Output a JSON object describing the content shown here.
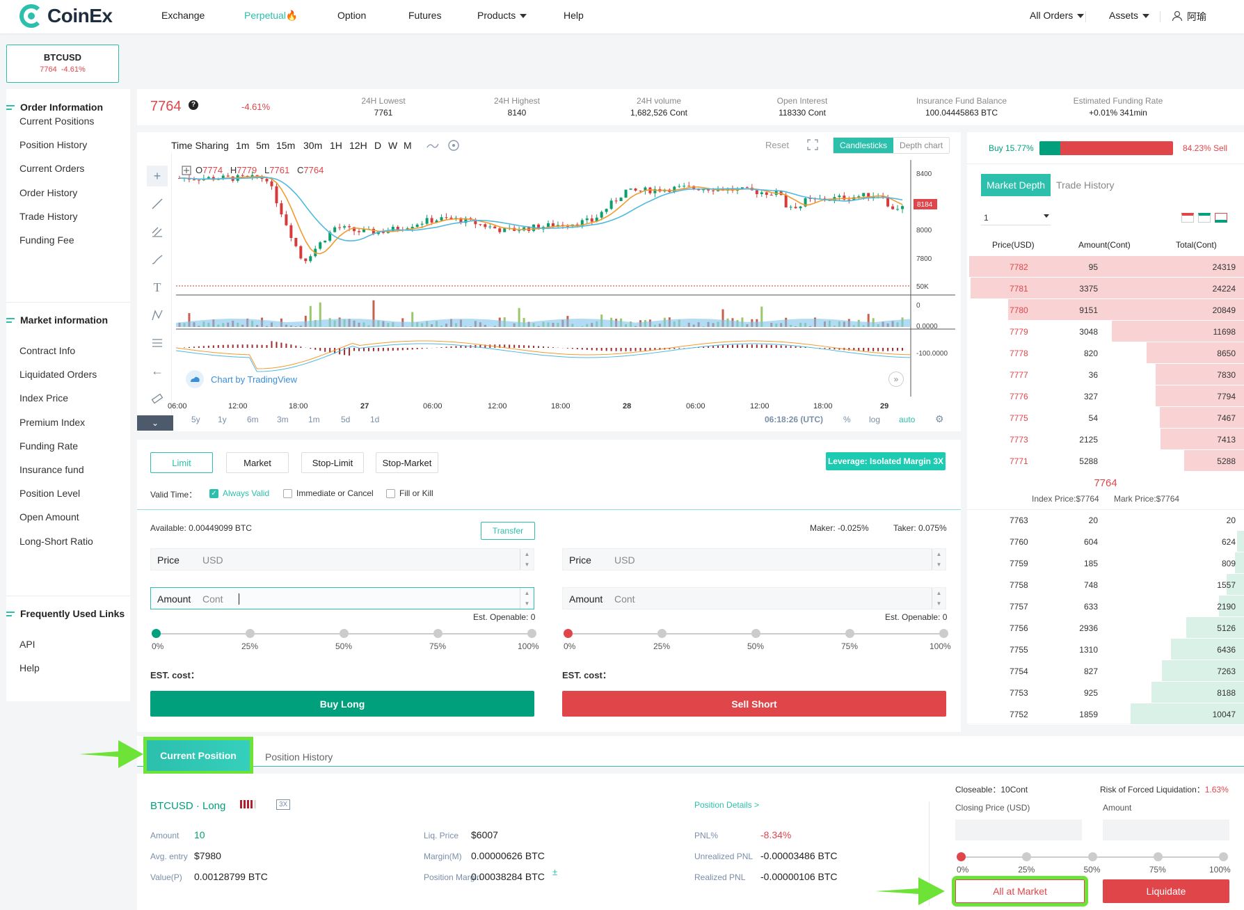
{
  "brand": {
    "name": "CoinEx"
  },
  "nav": {
    "items": [
      "Exchange",
      "Perpetual🔥",
      "Option",
      "Futures",
      "Products",
      "Help"
    ],
    "all_orders": "All Orders",
    "assets": "Assets",
    "user": "阿瑜"
  },
  "symbol": {
    "name": "BTCUSD",
    "price": "7764",
    "change": "-4.61%"
  },
  "sidebar": {
    "order_info": "Order Information",
    "order_items": [
      "Current Positions",
      "Position History",
      "Current Orders",
      "Order History",
      "Trade History",
      "Funding Fee"
    ],
    "market_info": "Market information",
    "market_items": [
      "Contract Info",
      "Liquidated Orders",
      "Index Price",
      "Premium Index",
      "Funding Rate",
      "Insurance fund",
      "Position Level",
      "Open Amount",
      "Long-Short Ratio"
    ],
    "links": "Frequently Used Links",
    "link_items": [
      "API",
      "Help"
    ]
  },
  "ticker": {
    "price": "7764",
    "change": "-4.61%",
    "stats": [
      {
        "label": "24H Lowest",
        "value": "7761"
      },
      {
        "label": "24H Highest",
        "value": "8140"
      },
      {
        "label": "24H volume",
        "value": "1,682,526 Cont"
      },
      {
        "label": "Open Interest",
        "value": "118330 Cont"
      },
      {
        "label": "Insurance Fund Balance",
        "value": "100.04445863 BTC"
      },
      {
        "label": "Estimated Funding Rate",
        "value": "+0.01% 341min"
      }
    ]
  },
  "chart": {
    "timeframes": [
      "Time Sharing",
      "1m",
      "5m",
      "15m",
      "30m",
      "1H",
      "12H",
      "D",
      "W",
      "M"
    ],
    "reset": "Reset",
    "types": [
      "Candlesticks",
      "Depth chart"
    ],
    "ohlc": {
      "o": "O",
      "o_val": "7774",
      "h": "H",
      "h_val": "7779",
      "l": "L",
      "l_val": "7761",
      "c": "C",
      "c_val": "7764"
    },
    "y_ticks": [
      "8400",
      "8184",
      "8000",
      "7800"
    ],
    "vol_ticks": [
      "50K",
      "0"
    ],
    "macd_ticks": [
      "0.0000",
      "-100.0000"
    ],
    "x_ticks": [
      "06:00",
      "12:00",
      "18:00",
      "27",
      "06:00",
      "12:00",
      "18:00",
      "28",
      "06:00",
      "12:00",
      "18:00",
      "29"
    ],
    "ranges": [
      "5y",
      "1y",
      "6m",
      "3m",
      "1m",
      "5d",
      "1d"
    ],
    "time": "06:18:26 (UTC)",
    "pct": "%",
    "log": "log",
    "auto": "auto",
    "attribution": "Chart by TradingView"
  },
  "ratio": {
    "buy": "Buy 15.77%",
    "sell": "84.23% Sell",
    "buy_fraction": 0.1577
  },
  "book": {
    "tabs": [
      "Market Depth",
      "Trade History"
    ],
    "precision": "1",
    "headers": [
      "Price(USD)",
      "Amount(Cont)",
      "Total(Cont)"
    ],
    "asks": [
      [
        "7782",
        "95",
        "24319"
      ],
      [
        "7781",
        "3375",
        "24224"
      ],
      [
        "7780",
        "9151",
        "20849"
      ],
      [
        "7779",
        "3048",
        "11698"
      ],
      [
        "7778",
        "820",
        "8650"
      ],
      [
        "7777",
        "36",
        "7830"
      ],
      [
        "7776",
        "327",
        "7794"
      ],
      [
        "7775",
        "54",
        "7467"
      ],
      [
        "7773",
        "2125",
        "7413"
      ],
      [
        "7771",
        "5288",
        "5288"
      ]
    ],
    "last": "7764",
    "index": "Index Price:$7764",
    "mark": "Mark Price:$7764",
    "bids": [
      [
        "7763",
        "20",
        "20"
      ],
      [
        "7760",
        "604",
        "624"
      ],
      [
        "7759",
        "185",
        "809"
      ],
      [
        "7758",
        "748",
        "1557"
      ],
      [
        "7757",
        "633",
        "2190"
      ],
      [
        "7756",
        "2936",
        "5126"
      ],
      [
        "7755",
        "1310",
        "6436"
      ],
      [
        "7754",
        "827",
        "7263"
      ],
      [
        "7753",
        "925",
        "8188"
      ],
      [
        "7752",
        "1859",
        "10047"
      ]
    ]
  },
  "trade": {
    "types": [
      "Limit",
      "Market",
      "Stop-Limit",
      "Stop-Market"
    ],
    "leverage": "Leverage: Isolated Margin 3X",
    "valid_time": "Valid Time：",
    "valid_opts": [
      "Always Valid",
      "Immediate or Cancel",
      "Fill or Kill"
    ],
    "available": "Available: 0.00449099 BTC",
    "transfer": "Transfer",
    "maker": "Maker: -0.025%",
    "taker": "Taker: 0.075%",
    "price": "Price",
    "usd": "USD",
    "amount": "Amount",
    "cont": "Cont",
    "openable": "Est. Openable: 0",
    "pcts": [
      "0%",
      "25%",
      "50%",
      "75%",
      "100%"
    ],
    "est_cost": "EST. cost：",
    "buy": "Buy Long",
    "sell": "Sell Short"
  },
  "positions": {
    "tabs": [
      "Current Position",
      "Position History"
    ],
    "symbol": "BTCUSD · Long",
    "lev": "3X",
    "details": "Position Details >",
    "fields": [
      {
        "label": "Amount",
        "value": "10"
      },
      {
        "label": "Avg. entry",
        "value": "$7980"
      },
      {
        "label": "Value(P)",
        "value": "0.00128799 BTC"
      },
      {
        "label": "Liq. Price",
        "value": "$6007"
      },
      {
        "label": "Margin(M)",
        "value": "0.00000626 BTC"
      },
      {
        "label": "Position Margin",
        "value": "0.00038284 BTC"
      },
      {
        "label": "PNL%",
        "value": "-8.34%"
      },
      {
        "label": "Unrealized PNL",
        "value": "-0.00003486 BTC"
      },
      {
        "label": "Realized PNL",
        "value": "-0.00000106 BTC"
      }
    ],
    "add": "±",
    "closeable_label": "Closeable：",
    "closeable": "10Cont",
    "risk_label": "Risk of Forced Liquidation：",
    "risk": "1.63%",
    "closing_price": "Closing Price (USD)",
    "amount": "Amount",
    "pcts": [
      "0%",
      "25%",
      "50%",
      "75%",
      "100%"
    ],
    "all_market": "All at Market",
    "liquidate": "Liquidate"
  },
  "colors": {
    "accent": "#2bbfac",
    "red": "#e0454a",
    "green": "#00a07c",
    "highlight": "#6ee337"
  }
}
